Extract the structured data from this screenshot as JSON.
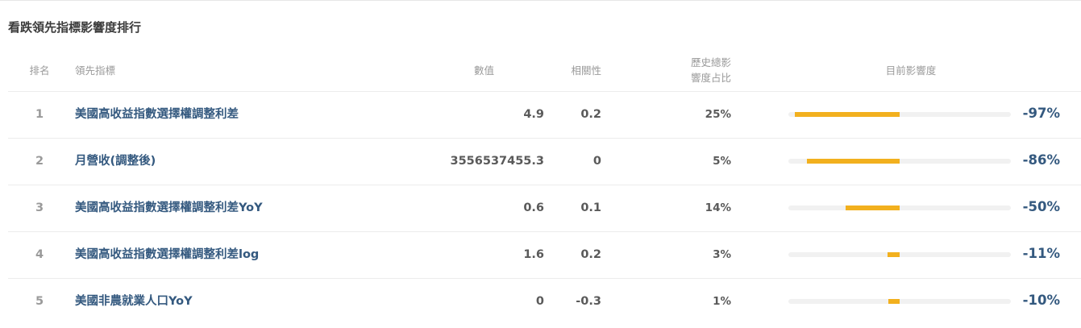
{
  "title": "看跌領先指標影響度排行",
  "headers": {
    "rank": "排名",
    "indicator": "領先指標",
    "value": "數值",
    "correlation": "相關性",
    "history_share_line1": "歷史總影",
    "history_share_line2": "響度占比",
    "current_impact": "目前影響度"
  },
  "colors": {
    "bar": "#f2b01e",
    "track": "#f1f1f1",
    "link": "#34597f"
  },
  "rows": [
    {
      "rank": "1",
      "indicator": "美國高收益指數選擇權調整利差",
      "value": "4.9",
      "correlation": "0.2",
      "share": "25%",
      "impact": "-97%",
      "impact_fraction": 0.97
    },
    {
      "rank": "2",
      "indicator": "月營收(調整後)",
      "value": "3556537455.3",
      "correlation": "0",
      "share": "5%",
      "impact": "-86%",
      "impact_fraction": 0.86
    },
    {
      "rank": "3",
      "indicator": "美國高收益指數選擇權調整利差YoY",
      "value": "0.6",
      "correlation": "0.1",
      "share": "14%",
      "impact": "-50%",
      "impact_fraction": 0.5
    },
    {
      "rank": "4",
      "indicator": "美國高收益指數選擇權調整利差log",
      "value": "1.6",
      "correlation": "0.2",
      "share": "3%",
      "impact": "-11%",
      "impact_fraction": 0.11
    },
    {
      "rank": "5",
      "indicator": "美國非農就業人口YoY",
      "value": "0",
      "correlation": "-0.3",
      "share": "1%",
      "impact": "-10%",
      "impact_fraction": 0.1
    }
  ]
}
